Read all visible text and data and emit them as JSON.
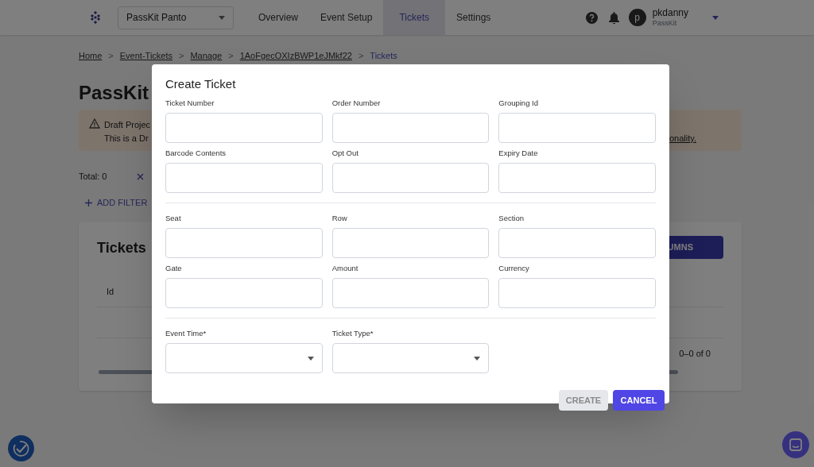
{
  "header": {
    "project": "PassKit Panto",
    "tabs": [
      {
        "label": "Overview",
        "selected": false
      },
      {
        "label": "Event Setup",
        "selected": false
      },
      {
        "label": "Tickets",
        "selected": true
      },
      {
        "label": "Settings",
        "selected": false
      }
    ],
    "user": {
      "initial": "p",
      "name": "pkdanny",
      "org": "PassKit"
    }
  },
  "breadcrumb": [
    {
      "label": "Home",
      "current": false
    },
    {
      "separator": ">",
      "label": "Event-Tickets",
      "current": false
    },
    {
      "separator": ">",
      "label": "Manage",
      "current": false
    },
    {
      "separator": ">",
      "label": "1AoFgecOXIzBWP1eJMkf22",
      "current": false
    },
    {
      "separator": ">",
      "label": "Tickets",
      "current": true
    }
  ],
  "page_title": "PassKit",
  "banner": {
    "title": "Draft Projec",
    "text_start": "This is a Dr",
    "text_end": "onality."
  },
  "total": "Total: 0",
  "add_filter": "ADD FILTER",
  "card": {
    "title": "Tickets",
    "button": "UMNS",
    "column": "Id",
    "pagination": "0–0 of 0"
  },
  "dialog": {
    "title": "Create Ticket",
    "groups": [
      [
        {
          "label": "Ticket Number",
          "kind": "text"
        },
        {
          "label": "Order Number",
          "kind": "text"
        },
        {
          "label": "Grouping Id",
          "kind": "text"
        },
        {
          "label": "Barcode Contents",
          "kind": "text"
        },
        {
          "label": "Opt Out",
          "kind": "text"
        },
        {
          "label": "Expiry Date",
          "kind": "text"
        }
      ],
      [
        {
          "label": "Seat",
          "kind": "text"
        },
        {
          "label": "Row",
          "kind": "text"
        },
        {
          "label": "Section",
          "kind": "text"
        },
        {
          "label": "Gate",
          "kind": "text"
        },
        {
          "label": "Amount",
          "kind": "text"
        },
        {
          "label": "Currency",
          "kind": "text"
        }
      ],
      [
        {
          "label": "Event Time*",
          "kind": "select"
        },
        {
          "label": "Ticket Type*",
          "kind": "select"
        }
      ]
    ],
    "buttons": [
      {
        "label": "CREATE",
        "disabled": true
      },
      {
        "label": "CANCEL",
        "disabled": false
      }
    ]
  }
}
